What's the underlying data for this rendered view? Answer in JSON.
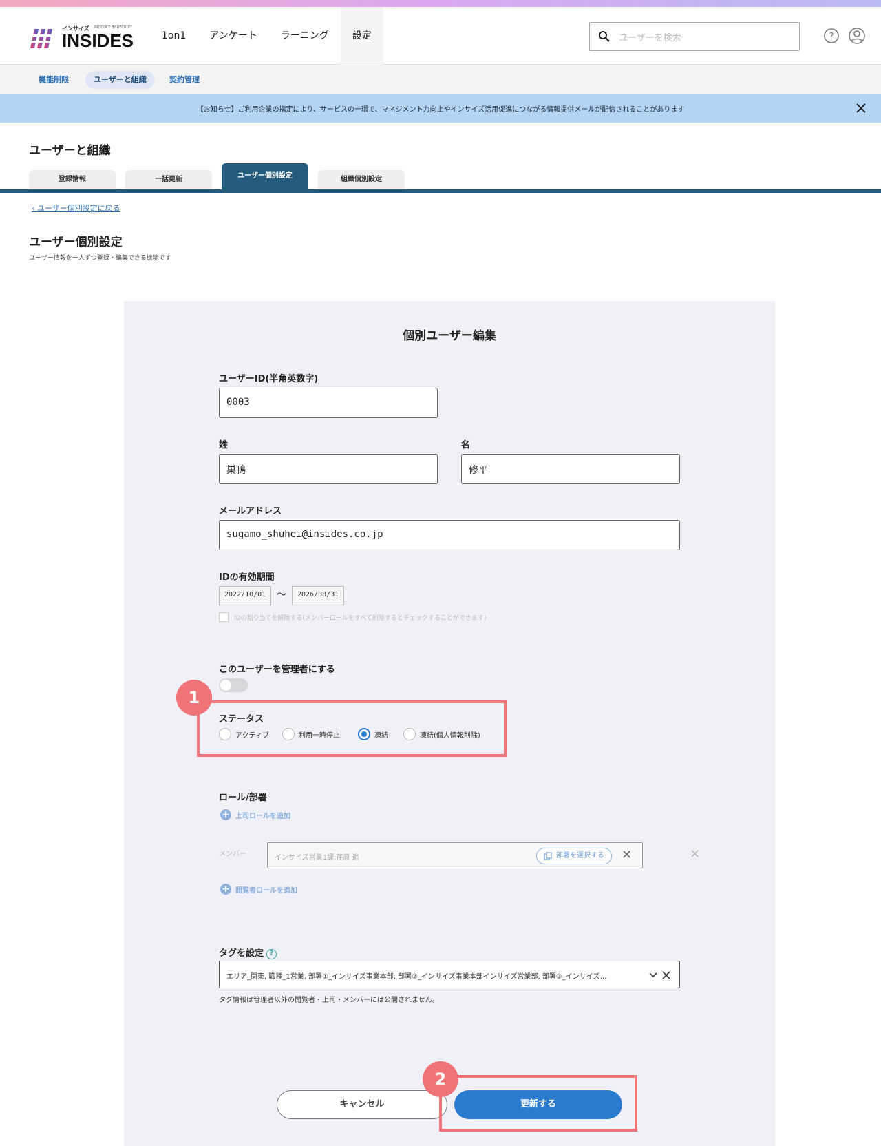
{
  "app": {
    "logo_kana": "インサイズ",
    "logo_word": "INSIDES",
    "logo_tag": "PRODUCT BY RECRUIT"
  },
  "nav": {
    "items": [
      {
        "label": "1on1"
      },
      {
        "label": "アンケート"
      },
      {
        "label": "ラーニング"
      },
      {
        "label": "設定"
      }
    ],
    "active": "設定"
  },
  "search": {
    "placeholder": "ユーザーを検索"
  },
  "subnav": {
    "items": [
      {
        "label": "機能制限"
      },
      {
        "label": "ユーザーと組織"
      },
      {
        "label": "契約管理"
      }
    ],
    "active": "ユーザーと組織"
  },
  "notice": {
    "text": "【お知らせ】ご利用企業の指定により、サービスの一環で、マネジメント力向上やインサイズ活用促進につながる情報提供メールが配信されることがあります"
  },
  "page": {
    "title": "ユーザーと組織"
  },
  "tabs": [
    {
      "label": "登録情報"
    },
    {
      "label": "一括更新"
    },
    {
      "label": "ユーザー個別設定"
    },
    {
      "label": "組織個別設定"
    }
  ],
  "active_tab": "ユーザー個別設定",
  "back_link": "ユーザー個別設定に戻る",
  "section": {
    "title": "ユーザー個別設定",
    "desc": "ユーザー情報を一人ずつ登録・編集できる機能です"
  },
  "form": {
    "title": "個別ユーザー編集",
    "user_id_label": "ユーザーID(半角英数字)",
    "user_id_value": "0003",
    "last_name_label": "姓",
    "last_name_value": "巣鴨",
    "first_name_label": "名",
    "first_name_value": "修平",
    "email_label": "メールアドレス",
    "email_value": "sugamo_shuhei@insides.co.jp",
    "validity_label": "IDの有効期間",
    "validity_from": "2022/10/01",
    "validity_sep": "〜",
    "validity_to": "2026/08/31",
    "unassign_text": "IDの割り当てを解除する(メンバーロールをすべて削除するとチェックすることができます)",
    "admin_label": "このユーザーを管理者にする",
    "admin_on": false,
    "status_label": "ステータス",
    "status_options": [
      {
        "label": "アクティブ"
      },
      {
        "label": "利用一時停止"
      },
      {
        "label": "凍結"
      },
      {
        "label": "凍結(個人情報削除)"
      }
    ],
    "status_selected": "凍結",
    "roles_label": "ロール/部署",
    "add_boss_role": "上司ロールを追加",
    "member_label": "メンバー",
    "member_value": "インサイズ営業1課:荏原 進",
    "select_dept": "部署を選択する",
    "add_viewer_role": "閲覧者ロールを追加",
    "tags_label": "タグを設定",
    "tags_value": "エリア_関東, 職種_1営業, 部署①_インサイズ事業本部, 部署②_インサイズ事業本部インサイズ営業部, 部署③_インサイズ…",
    "tags_note": "タグ情報は管理者以外の閲覧者・上司・メンバーには公開されません。",
    "cancel": "キャンセル",
    "update": "更新する"
  },
  "annotations": [
    {
      "label": "1"
    },
    {
      "label": "2"
    }
  ],
  "colors": {
    "accent": "#2a7bd0",
    "tab_active": "#245a7c",
    "highlight": "#f07377",
    "notice_bg": "#b3d4f3"
  }
}
